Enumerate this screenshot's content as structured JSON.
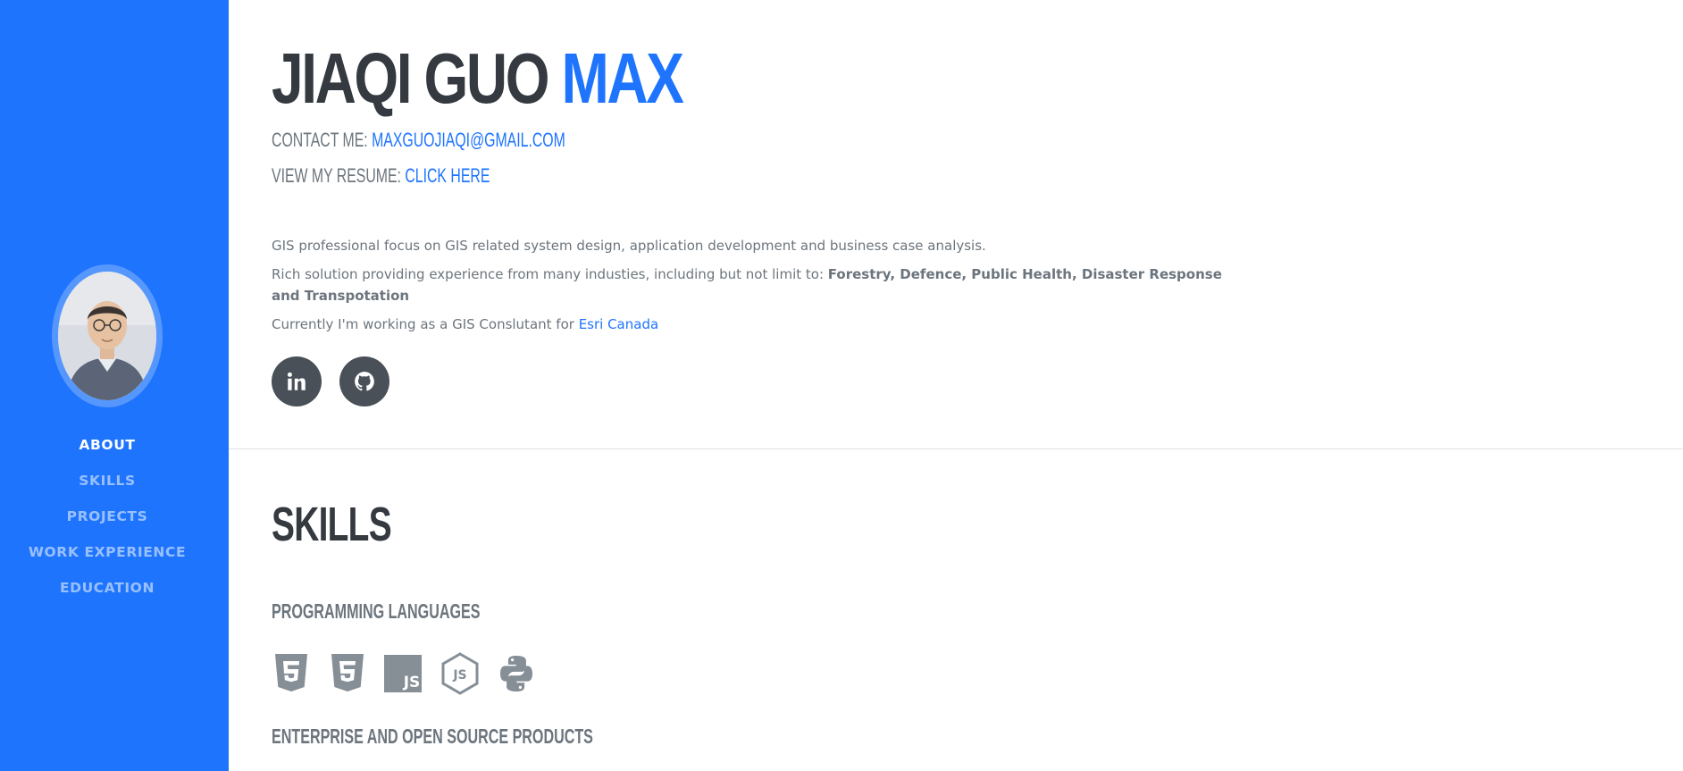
{
  "sidebar": {
    "bg_color": "#1e74fd",
    "avatar_alt": "profile-photo",
    "nav": [
      {
        "label": "ABOUT",
        "active": true
      },
      {
        "label": "SKILLS",
        "active": false
      },
      {
        "label": "PROJECTS",
        "active": false
      },
      {
        "label": "WORK EXPERIENCE",
        "active": false
      },
      {
        "label": "EDUCATION",
        "active": false
      }
    ]
  },
  "about": {
    "first_name": "JIAQI GUO",
    "nickname": "MAX",
    "contact_label": "CONTACT ME:",
    "contact_email": "MAXGUOJIAQI@GMAIL.COM",
    "resume_label": "VIEW MY RESUME:",
    "resume_link": "CLICK HERE",
    "p1": "GIS professional focus on GIS related system design, application development and business case analysis.",
    "p2_text": "Rich solution providing experience from many industies, including but not limit to: ",
    "p2_bold": "Forestry, Defence, Public Health, Disaster Response and Transpotation",
    "p3_text": "Currently I'm working as a GIS Conslutant for ",
    "p3_link": "Esri Canada",
    "socials": [
      {
        "icon": "linkedin-icon"
      },
      {
        "icon": "github-icon"
      }
    ]
  },
  "skills": {
    "title": "SKILLS",
    "programming_heading": "PROGRAMMING LANGUAGES",
    "programming_icons": [
      "html5-icon",
      "css3-icon",
      "javascript-icon",
      "nodejs-icon",
      "python-icon"
    ],
    "enterprise_heading": "ENTERPRISE AND OPEN SOURCE PRODUCTS"
  },
  "colors": {
    "accent": "#1e74fd",
    "heading": "#343a40",
    "muted": "#6c757d",
    "icon_gray": "#868e96"
  }
}
